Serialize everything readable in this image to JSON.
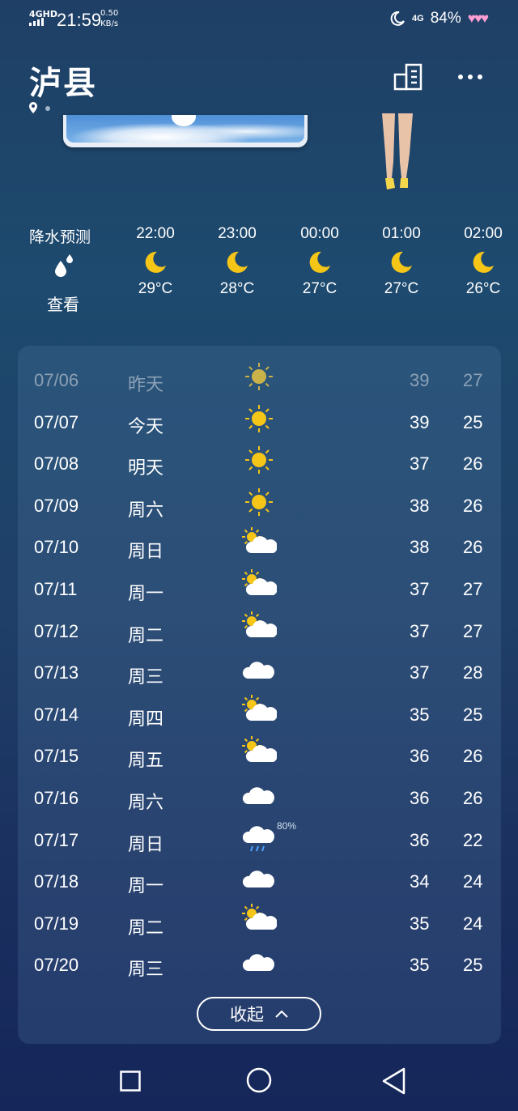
{
  "status": {
    "network": "4GHD",
    "time": "21:59",
    "speed_value": "0.50",
    "speed_unit": "KB/s",
    "mobile": "4G",
    "battery": "84%",
    "hearts": "♥♥♥"
  },
  "header": {
    "city": "泸县"
  },
  "hourly": {
    "precip_label": "降水预测",
    "precip_view": "查看",
    "items": [
      {
        "time": "22:00",
        "temp": "29°C",
        "icon": "moon-icon"
      },
      {
        "time": "23:00",
        "temp": "28°C",
        "icon": "moon-icon"
      },
      {
        "time": "00:00",
        "temp": "27°C",
        "icon": "moon-icon"
      },
      {
        "time": "01:00",
        "temp": "27°C",
        "icon": "moon-icon"
      },
      {
        "time": "02:00",
        "temp": "26°C",
        "icon": "moon-icon"
      }
    ]
  },
  "daily": [
    {
      "date": "07/06",
      "day": "昨天",
      "icon": "sun",
      "hi": "39",
      "lo": "27",
      "past": true
    },
    {
      "date": "07/07",
      "day": "今天",
      "icon": "sun",
      "hi": "39",
      "lo": "25"
    },
    {
      "date": "07/08",
      "day": "明天",
      "icon": "sun",
      "hi": "37",
      "lo": "26"
    },
    {
      "date": "07/09",
      "day": "周六",
      "icon": "sun",
      "hi": "38",
      "lo": "26"
    },
    {
      "date": "07/10",
      "day": "周日",
      "icon": "partly",
      "hi": "38",
      "lo": "26"
    },
    {
      "date": "07/11",
      "day": "周一",
      "icon": "partly",
      "hi": "37",
      "lo": "27"
    },
    {
      "date": "07/12",
      "day": "周二",
      "icon": "partly",
      "hi": "37",
      "lo": "27"
    },
    {
      "date": "07/13",
      "day": "周三",
      "icon": "cloud",
      "hi": "37",
      "lo": "28"
    },
    {
      "date": "07/14",
      "day": "周四",
      "icon": "partly",
      "hi": "35",
      "lo": "25"
    },
    {
      "date": "07/15",
      "day": "周五",
      "icon": "partly",
      "hi": "36",
      "lo": "26"
    },
    {
      "date": "07/16",
      "day": "周六",
      "icon": "cloud",
      "hi": "36",
      "lo": "26"
    },
    {
      "date": "07/17",
      "day": "周日",
      "icon": "rain",
      "pct": "80%",
      "hi": "36",
      "lo": "22"
    },
    {
      "date": "07/18",
      "day": "周一",
      "icon": "cloud",
      "hi": "34",
      "lo": "24"
    },
    {
      "date": "07/19",
      "day": "周二",
      "icon": "partly",
      "hi": "35",
      "lo": "24"
    },
    {
      "date": "07/20",
      "day": "周三",
      "icon": "cloud",
      "hi": "35",
      "lo": "25"
    }
  ],
  "collapse_label": "收起",
  "colors": {
    "sun": "#f5c518",
    "moon": "#f5c518",
    "cloud": "#ffffff",
    "rain": "#4fa3ff"
  }
}
